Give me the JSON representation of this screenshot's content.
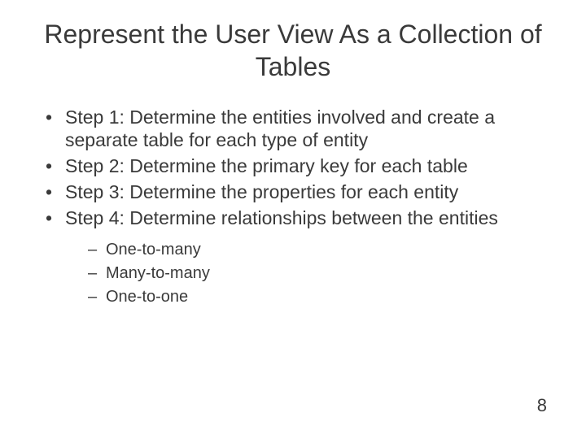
{
  "title": "Represent the User View As a Collection of Tables",
  "bullets": [
    {
      "text": "Step 1: Determine the entities involved and create a separate table for each type of entity"
    },
    {
      "text": "Step 2: Determine the primary key for each table"
    },
    {
      "text": "Step 3: Determine the properties for each entity"
    },
    {
      "text": "Step 4: Determine relationships between the entities",
      "sub": [
        "One-to-many",
        "Many-to-many",
        "One-to-one"
      ]
    }
  ],
  "page_number": "8"
}
